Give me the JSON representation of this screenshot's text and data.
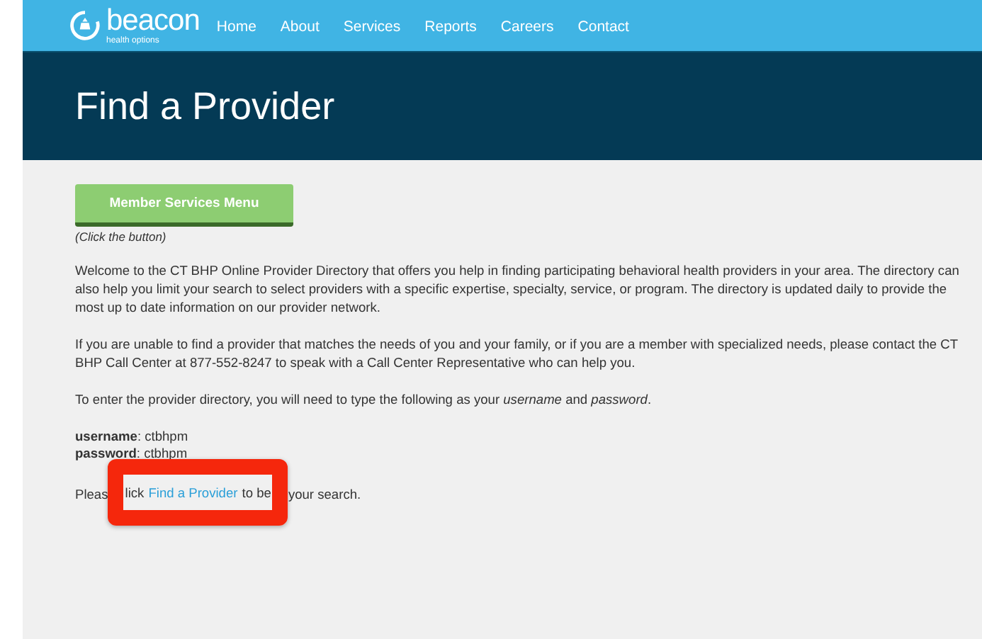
{
  "nav": {
    "brand": "beacon",
    "tagline": "health options",
    "items": [
      {
        "label": "Home"
      },
      {
        "label": "About"
      },
      {
        "label": "Services"
      },
      {
        "label": "Reports"
      },
      {
        "label": "Careers"
      },
      {
        "label": "Contact"
      }
    ]
  },
  "header": {
    "title": "Find a Provider"
  },
  "content": {
    "button": "Member Services Menu",
    "button_note": "(Click the button)",
    "paragraphs": [
      "Welcome to the CT BHP Online Provider Directory that offers you help in finding participating behavioral health providers in your area. The directory can also help you limit your search to select providers with a specific expertise, specialty, service, or program. The directory is updated daily to provide the most up to date information on our provider network.",
      "If you are unable to find a provider that matches the needs of you and your family, or if you are a member with specialized needs, please contact the CT BHP Call Center at 877-552-8247 to speak with a Call Center Representative who can help you.",
      "To enter the provider directory, you will need to type the following as your *username* and *password*."
    ],
    "credentials": [
      "**username**: ctbhpm",
      "**password**: ctbhpm"
    ],
    "final_line": {
      "before": "Pleas",
      "inside_before": "lick",
      "link": "Find a Provider",
      "inside_after": "to be",
      "after": "your search."
    }
  }
}
